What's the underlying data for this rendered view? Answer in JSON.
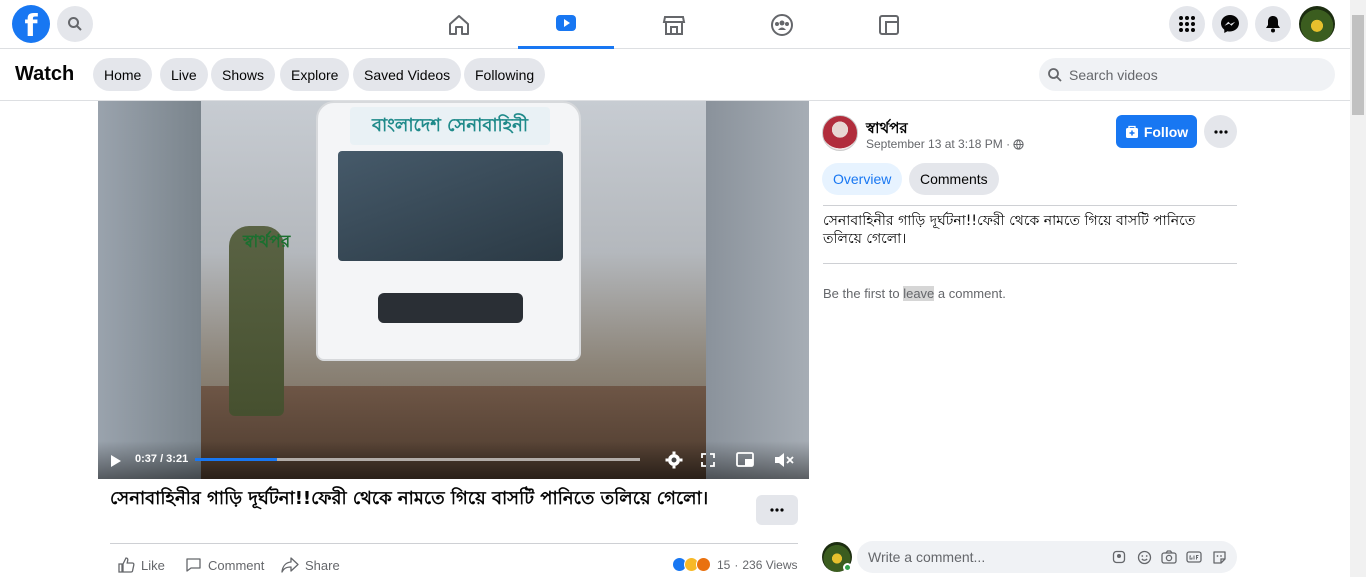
{
  "topbar": {
    "logo_letter": "f",
    "nav_tabs": [
      "home",
      "watch",
      "marketplace",
      "groups",
      "gaming"
    ],
    "active_tab": "watch"
  },
  "watch": {
    "title": "Watch",
    "pills": [
      "Home",
      "Live",
      "Shows",
      "Explore",
      "Saved Videos",
      "Following"
    ],
    "search_placeholder": "Search videos"
  },
  "video": {
    "bus_sign": "বাংলাদেশ সেনাবাহিনী",
    "watermark": "স্বার্থপর",
    "time": "0:37 / 3:21",
    "progress": 0.185,
    "title": "সেনাবাহিনীর গাড়ি দূর্ঘটনা!!ফেরী থেকে নামতে গিয়ে বাসটি পানিতে তলিয়ে গেলো।"
  },
  "actions": {
    "like": "Like",
    "comment": "Comment",
    "share": "Share",
    "reaction_count": "15",
    "views": "236 Views",
    "dot": "·"
  },
  "post": {
    "page_name": "স্বার্থপর",
    "date": "September 13 at 3:18 PM ·",
    "follow": "Follow",
    "tabs": [
      "Overview",
      "Comments"
    ],
    "text": "সেনাবাহিনীর গাড়ি দূর্ঘটনা!!ফেরী থেকে নামতে গিয়ে বাসটি পানিতে তলিয়ে গেলো।",
    "first_comment_prefix": "Be the first to ",
    "first_comment_highlight": "leave",
    "first_comment_suffix": " a comment.",
    "comment_placeholder": "Write a comment..."
  },
  "colors": {
    "brand": "#1877f2",
    "pill_bg": "#e4e6eb",
    "active_pill_bg": "#e7f3ff",
    "online": "#31a24c"
  }
}
